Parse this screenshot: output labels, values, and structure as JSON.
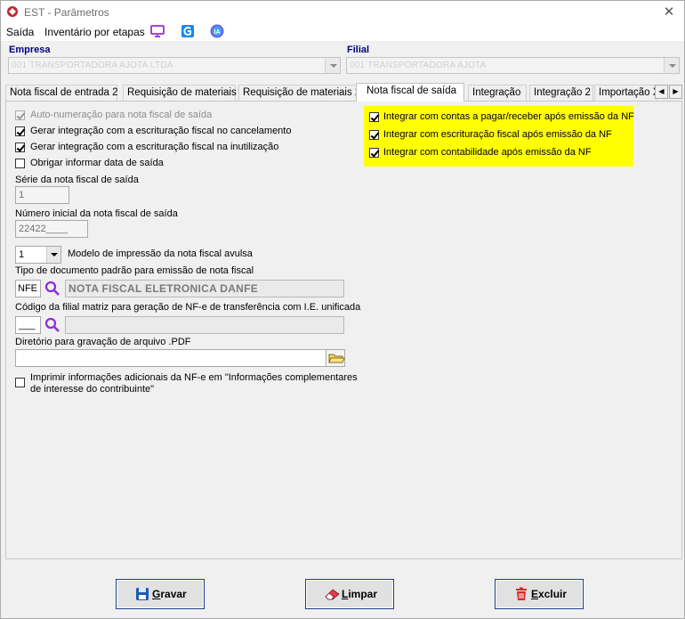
{
  "window": {
    "title": "EST - Parâmetros",
    "close": "✕"
  },
  "menu": {
    "items": [
      "Saída",
      "Inventário por etapas"
    ],
    "icons": [
      "monitor-icon",
      "g-app-icon",
      "ia-assistant-icon"
    ],
    "ia_label": "IA"
  },
  "header": {
    "empresa_label": "Empresa",
    "empresa_value": "001 TRANSPORTADORA AJOTA LTDA",
    "filial_label": "Filial",
    "filial_value": "001 TRANSPORTADORA AJOTA"
  },
  "tabs": [
    "Nota fiscal de entrada 2",
    "Requisição de materiais",
    "Requisição de materiais 2",
    "Nota fiscal de saída",
    "Integração",
    "Integração 2",
    "Importação X"
  ],
  "active_tab": "Nota fiscal de saída",
  "left": {
    "auto_numeracao": "Auto-numeração para nota fiscal de saída",
    "gerar_cancelamento": "Gerar integração com a escrituração fiscal no cancelamento",
    "gerar_inutilizacao": "Gerar integração com a escrituração fiscal na inutilização",
    "obrigar_data": "Obrigar informar data de saída",
    "serie_label": "Série da nota fiscal de saída",
    "serie_value": "1",
    "numero_label": "Número inicial da nota fiscal de saída",
    "numero_value": "22422____",
    "modelo_value": "1",
    "modelo_label": "Modelo de impressão da nota fiscal avulsa",
    "tipo_doc_label": "Tipo de documento padrão para emissão de nota fiscal",
    "tipo_doc_code": "NFE",
    "tipo_doc_desc": "NOTA FISCAL ELETRONICA DANFE",
    "codigo_filial_label": "Código da filial matriz para geração de NF-e de transferência com I.E. unificada",
    "codigo_filial_value": "___",
    "diretorio_label": "Diretório para gravação de arquivo .PDF",
    "diretorio_value": "",
    "imprimir_line1": "Imprimir informações adicionais da NF-e em \"Informações complementares",
    "imprimir_line2": "de interesse do contribuinte\""
  },
  "right": {
    "integrar_contas": "Integrar com contas a pagar/receber após emissão da NF",
    "integrar_escrituracao": "Integrar com escrituração fiscal após emissão da NF",
    "integrar_contabilidade": "Integrar com contabilidade após emissão da NF",
    "highlight_color": "#ffff00"
  },
  "buttons": {
    "gravar": "Gravar",
    "limpar": "Limpar",
    "excluir": "Excluir"
  },
  "colors": {
    "label_blue": "#000080",
    "button_border": "#1a3c8a",
    "accent_red": "#c0282d"
  }
}
